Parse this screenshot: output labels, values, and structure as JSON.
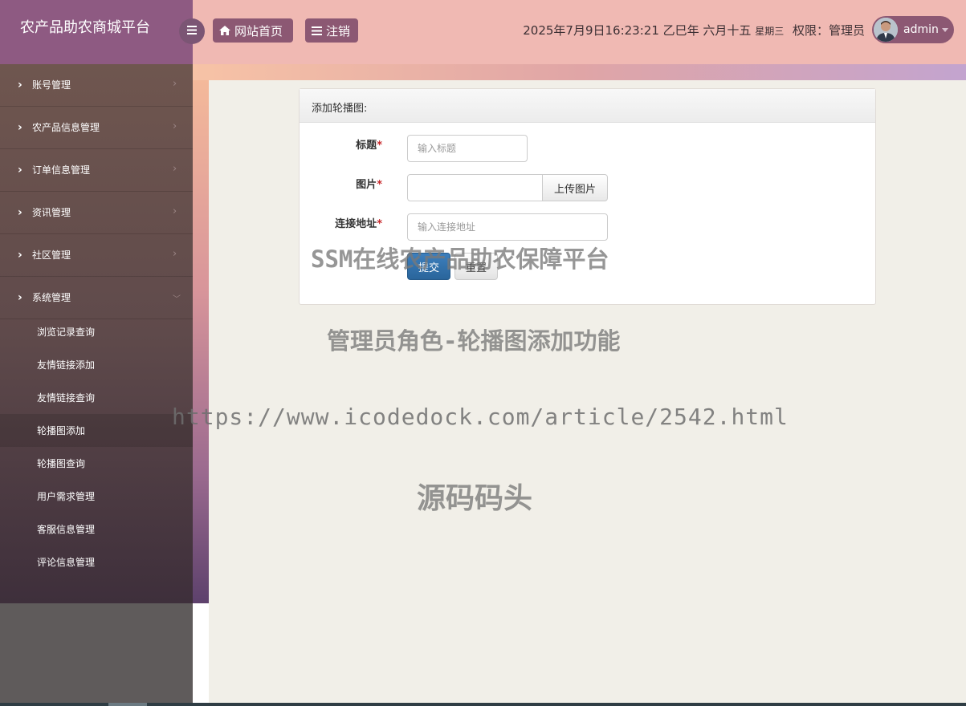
{
  "header": {
    "brand": "农产品助农商城平台",
    "home_button": "网站首页",
    "logout_button": "注销",
    "datetime": "2025年7月9日16:23:21 乙巳年 六月十五",
    "weekday": "星期三",
    "permission": "权限：管理员",
    "username": "admin"
  },
  "sidebar": {
    "menus": [
      {
        "label": "账号管理"
      },
      {
        "label": "农产品信息管理"
      },
      {
        "label": "订单信息管理"
      },
      {
        "label": "资讯管理"
      },
      {
        "label": "社区管理"
      },
      {
        "label": "系统管理"
      }
    ],
    "sub_items": [
      {
        "label": "浏览记录查询"
      },
      {
        "label": "友情链接添加"
      },
      {
        "label": "友情链接查询"
      },
      {
        "label": "轮播图添加"
      },
      {
        "label": "轮播图查询"
      },
      {
        "label": "用户需求管理"
      },
      {
        "label": "客服信息管理"
      },
      {
        "label": "评论信息管理"
      }
    ]
  },
  "form": {
    "title": "添加轮播图:",
    "fields": {
      "title_label": "标题",
      "title_placeholder": "输入标题",
      "image_label": "图片",
      "upload_label": "上传图片",
      "link_label": "连接地址",
      "link_placeholder": "输入连接地址"
    },
    "required_mark": "*",
    "submit_label": "提交",
    "reset_label": "重置"
  },
  "watermarks": {
    "line1": "SSM在线农产品助农保障平台",
    "line2": "管理员角色-轮播图添加功能",
    "line3": "https://www.icodedock.com/article/2542.html",
    "line4": "源码码头"
  },
  "icons": {
    "menu_toggle": "bars-icon",
    "home": "home-icon",
    "logout": "list-icon",
    "menu_chevron": "chevron-right-icon",
    "menu_end": "chevron-right-icon",
    "menu_end_open": "chevron-down-icon",
    "user_caret": "caret-down-icon"
  },
  "colors": {
    "header_bg": "#f0b9b3",
    "brand_bg": "#8e5a82",
    "button_bg": "#8c5873",
    "submit_bg": "#2a659b",
    "required": "#c7282b"
  }
}
